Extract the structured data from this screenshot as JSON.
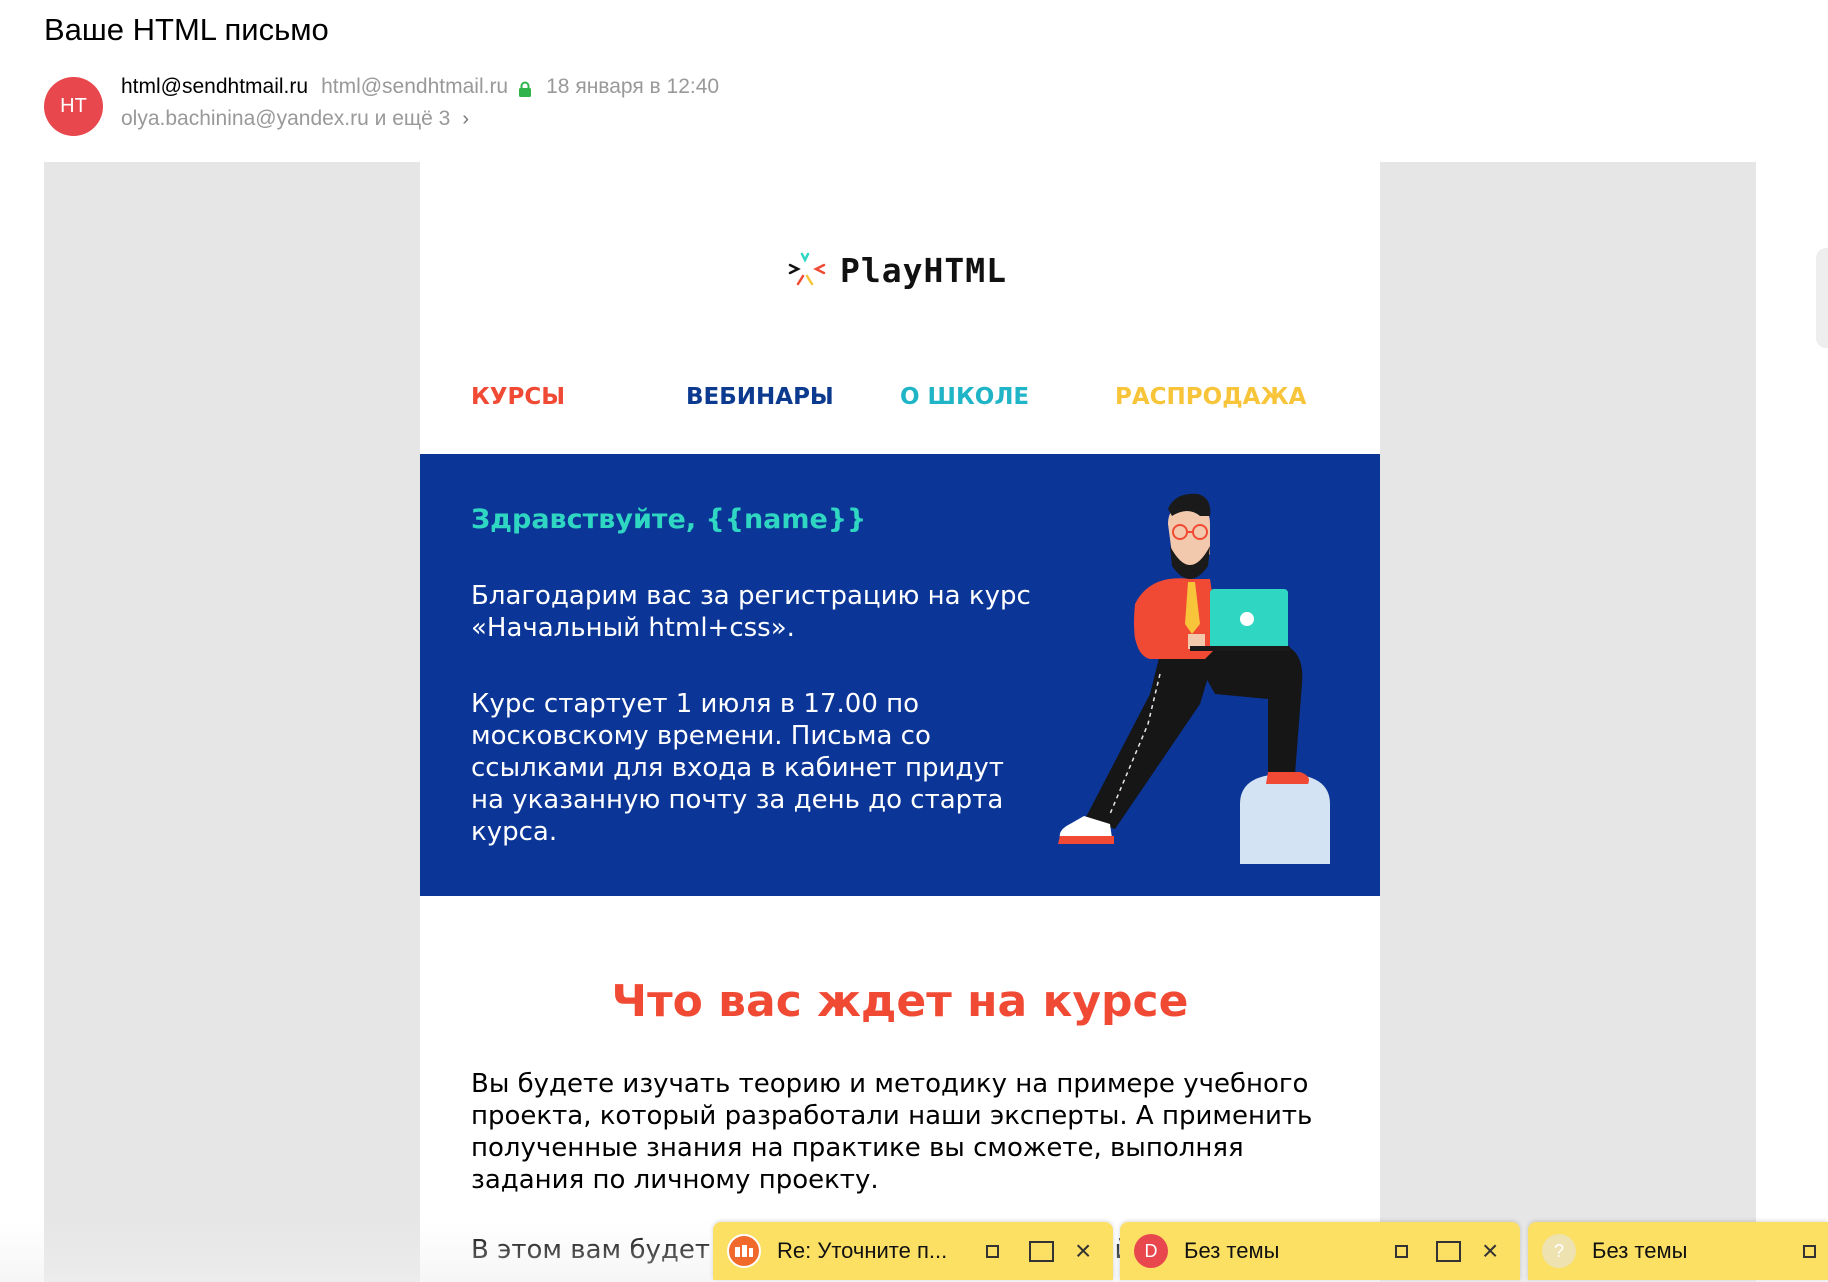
{
  "mail": {
    "subject": "Ваше HTML письмо",
    "avatar_initials": "HT",
    "sender_name": "html@sendhtmail.ru",
    "sender_email": "html@sendhtmail.ru",
    "date": "18 января в 12:40",
    "recipients": "olya.bachinina@yandex.ru и ещё 3",
    "colors": {
      "avatar": "#e8474d",
      "lock": "#2fb34a"
    }
  },
  "email": {
    "logo_text": "PlayHTML",
    "nav": [
      "КУРСЫ",
      "ВЕБИНАРЫ",
      "О ШКОЛЕ",
      "РАСПРОДАЖА"
    ],
    "hero": {
      "greeting": "Здравствуйте, {{name}}",
      "paragraph1": "Благодарим вас за регистрацию на курс «Начальный html+css».",
      "paragraph2": "Курс стартует 1 июля в 17.00 по московскому времени. Письма со ссылками для входа в кабинет придут на указанную почту за день до старта курса."
    },
    "section_title": "Что вас ждет на курсе",
    "body_p1": "Вы будете изучать теорию и методику на примере учебного проекта, который разработали наши эксперты. А применить полученные знания на практике вы сможете, выполняя задания по личному проекту.",
    "body_p2": "В этом вам будет помогать наставник, который проверит",
    "colors": {
      "hero_bg": "#0b3596",
      "accent_red": "#f04a35",
      "accent_teal": "#2fd7c3"
    }
  },
  "tabs": [
    {
      "label": "Re: Уточните п...",
      "icon": "avatar-icon"
    },
    {
      "label": "Без темы",
      "icon": "D"
    },
    {
      "label": "Без темы",
      "icon": "?"
    }
  ]
}
